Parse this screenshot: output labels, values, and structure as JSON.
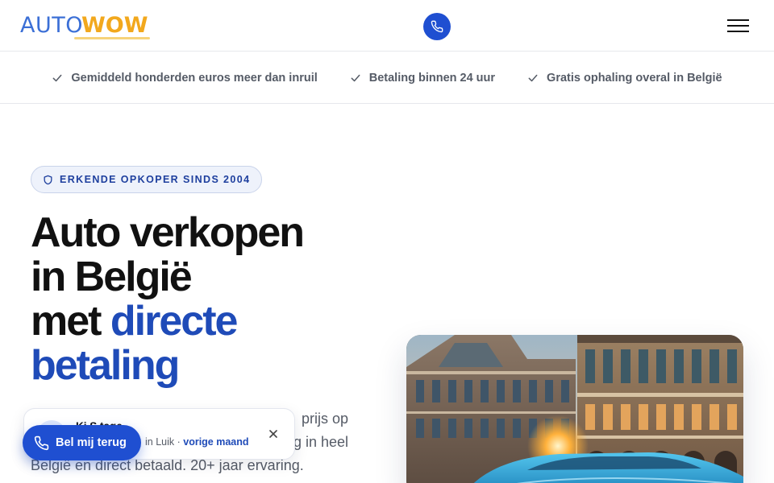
{
  "header": {
    "logo_part1": "AUTO",
    "logo_part2": "WOW",
    "phone_icon": "phone-icon",
    "menu_icon": "hamburger-menu-icon"
  },
  "benefits": [
    {
      "icon": "check-icon",
      "label": "Gemiddeld honderden euros meer dan inruil"
    },
    {
      "icon": "check-icon",
      "label": "Betaling binnen 24 uur"
    },
    {
      "icon": "check-icon",
      "label": "Gratis ophaling overal in België"
    }
  ],
  "hero": {
    "badge_icon": "shield-icon",
    "badge": "ERKENDE OPKOPER SINDS 2004",
    "title_line1": "Auto verkopen",
    "title_line2": "in België",
    "title_line3_plain": "met ",
    "title_line3_accent": "directe",
    "title_line4_accent": "betaling",
    "subtitle_line1": "prijs op",
    "subtitle_line2": "g in heel",
    "subtitle_line3": "België en direct betaald. 20+ jaar ervaring."
  },
  "notification": {
    "name": "Ki  S  tage",
    "location": "in Luik · ",
    "time": "vorige maand",
    "close_icon": "close-icon"
  },
  "callback": {
    "label": "Bel mij terug",
    "icon": "phone-icon"
  },
  "colors": {
    "primary": "#1f4fd1",
    "accent_text": "#1f4bb8",
    "logo_blue": "#3b6fd6",
    "logo_orange": "#f2a81d"
  }
}
